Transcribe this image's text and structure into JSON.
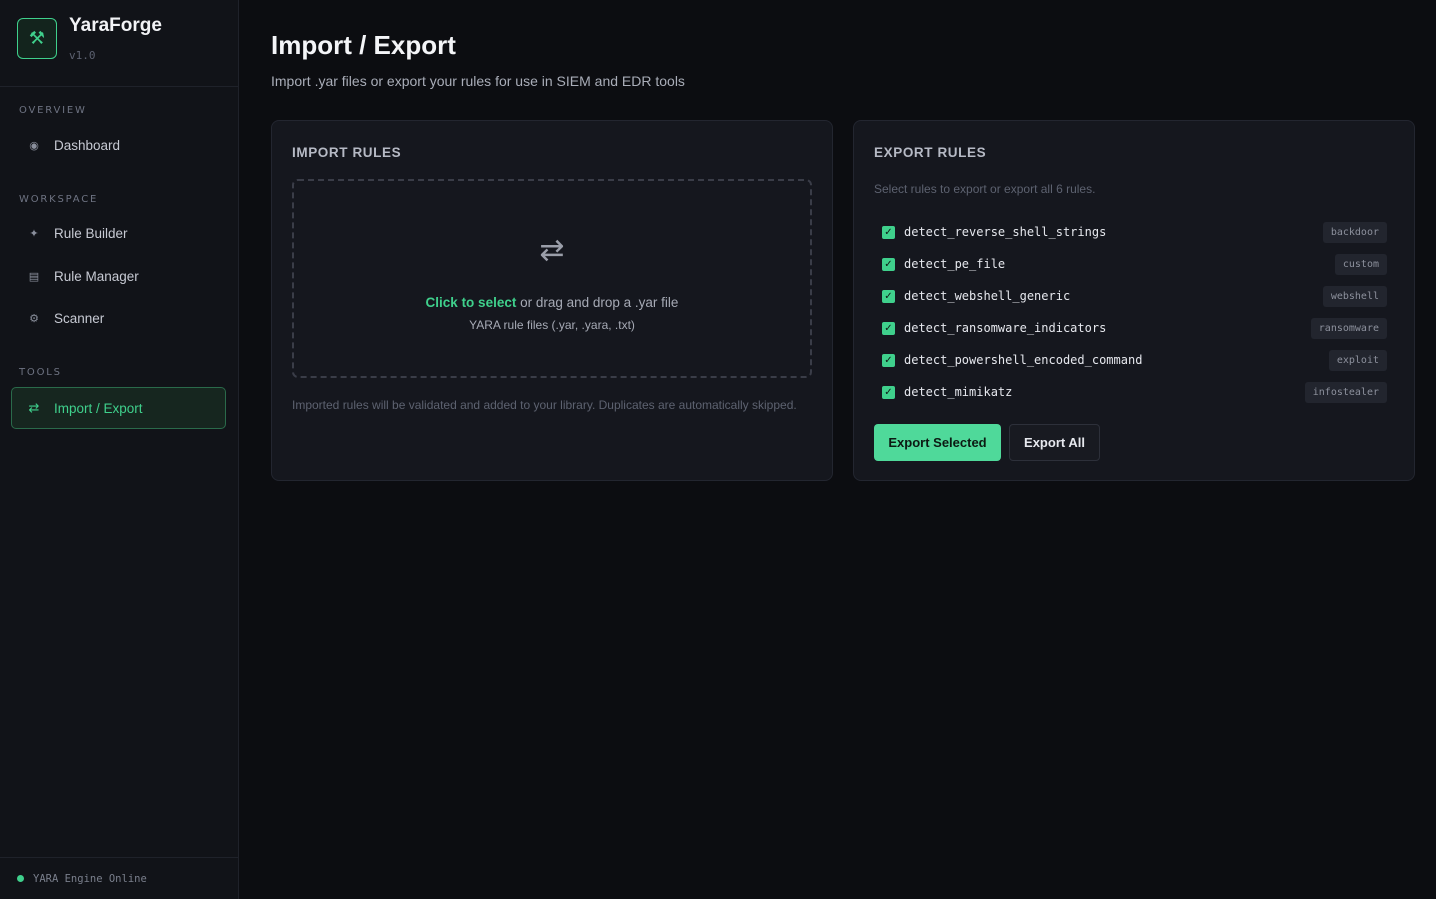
{
  "app": {
    "name": "YaraForge",
    "version": "v1.0"
  },
  "sidebar": {
    "sections": [
      {
        "label": "OVERVIEW"
      },
      {
        "label": "WORKSPACE"
      },
      {
        "label": "TOOLS"
      }
    ],
    "items": [
      {
        "label": "Dashboard",
        "icon": "circle-dot-icon"
      },
      {
        "label": "Rule Builder",
        "icon": "sparkle-icon"
      },
      {
        "label": "Rule Manager",
        "icon": "list-icon"
      },
      {
        "label": "Scanner",
        "icon": "gear-icon"
      },
      {
        "label": "Import / Export",
        "icon": "swap-icon",
        "active": true
      }
    ],
    "status": "YARA Engine Online"
  },
  "header": {
    "title": "Import / Export",
    "subtitle": "Import .yar files or export your rules for use in SIEM and EDR tools"
  },
  "import": {
    "title": "IMPORT RULES",
    "click_label": "Click to select",
    "drop_label": " or drag and drop a .yar file",
    "file_types": "YARA rule files (.yar, .yara, .txt)",
    "note": "Imported rules will be validated and added to your library. Duplicates are automatically skipped."
  },
  "export": {
    "title": "EXPORT RULES",
    "description": "Select rules to export or export all 6 rules.",
    "rules": [
      {
        "name": "detect_reverse_shell_strings",
        "tag": "backdoor",
        "checked": true
      },
      {
        "name": "detect_pe_file",
        "tag": "custom",
        "checked": true
      },
      {
        "name": "detect_webshell_generic",
        "tag": "webshell",
        "checked": true
      },
      {
        "name": "detect_ransomware_indicators",
        "tag": "ransomware",
        "checked": true
      },
      {
        "name": "detect_powershell_encoded_command",
        "tag": "exploit",
        "checked": true
      },
      {
        "name": "detect_mimikatz",
        "tag": "infostealer",
        "checked": true
      }
    ],
    "export_selected_label": "Export Selected",
    "export_all_label": "Export All"
  },
  "colors": {
    "accent": "#3fd08c",
    "background": "#0c0d11",
    "card": "#15171e"
  }
}
